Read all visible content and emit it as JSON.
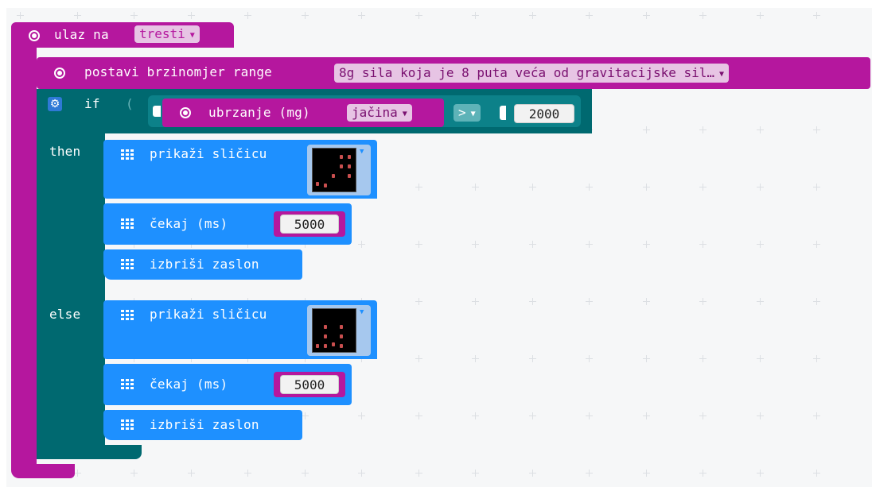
{
  "event": {
    "prefix": "ulaz na",
    "gesture": "tresti"
  },
  "range": {
    "label": "postavi brzinomjer range",
    "value": "8g sila koja je 8 puta veća od gravitacijske sil…"
  },
  "if_block": {
    "if_label": "if",
    "then_label": "then",
    "else_label": "else",
    "condition": {
      "sensor_label": "ubrzanje (mg)",
      "axis": "jačina",
      "operator": ">",
      "value": "2000"
    }
  },
  "then_branch": {
    "show_label": "prikaži sličicu",
    "pause_label": "čekaj (ms)",
    "pause_value": "5000",
    "clear_label": "izbriši zaslon"
  },
  "else_branch": {
    "show_label": "prikaži sličicu",
    "pause_label": "čekaj (ms)",
    "pause_value": "5000",
    "clear_label": "izbriši zaslon"
  },
  "colors": {
    "input_magenta": "#b5179e",
    "logic_teal": "#006970",
    "basic_blue": "#1e90ff",
    "field_pink": "#e7c4e4",
    "led_red": "#c94f4f"
  },
  "icons": [
    "target-icon",
    "gear-icon",
    "grid-icon",
    "dropdown-arrow-icon"
  ]
}
